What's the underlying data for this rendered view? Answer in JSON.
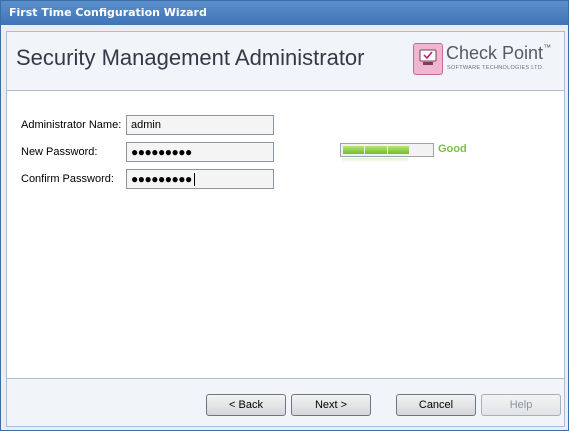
{
  "window": {
    "title": "First Time Configuration Wizard"
  },
  "header": {
    "page_title": "Security Management Administrator",
    "logo_name": "Check Point",
    "logo_subtitle": "SOFTWARE TECHNOLOGIES LTD.",
    "logo_trademark": "™"
  },
  "form": {
    "admin_name_label": "Administrator Name:",
    "admin_name_value": "admin",
    "new_password_label": "New Password:",
    "new_password_masked": "●●●●●●●●●",
    "confirm_password_label": "Confirm Password:",
    "confirm_password_masked": "●●●●●●●●●"
  },
  "strength": {
    "label": "Good",
    "level": 0.75,
    "color": "#7dc142"
  },
  "buttons": {
    "back": "< Back",
    "next": "Next >",
    "cancel": "Cancel",
    "help": "Help",
    "help_disabled": true
  },
  "colors": {
    "titlebar": "#4a80c0",
    "accent_green": "#7dc142",
    "logo_pink": "#f0b5cf"
  }
}
